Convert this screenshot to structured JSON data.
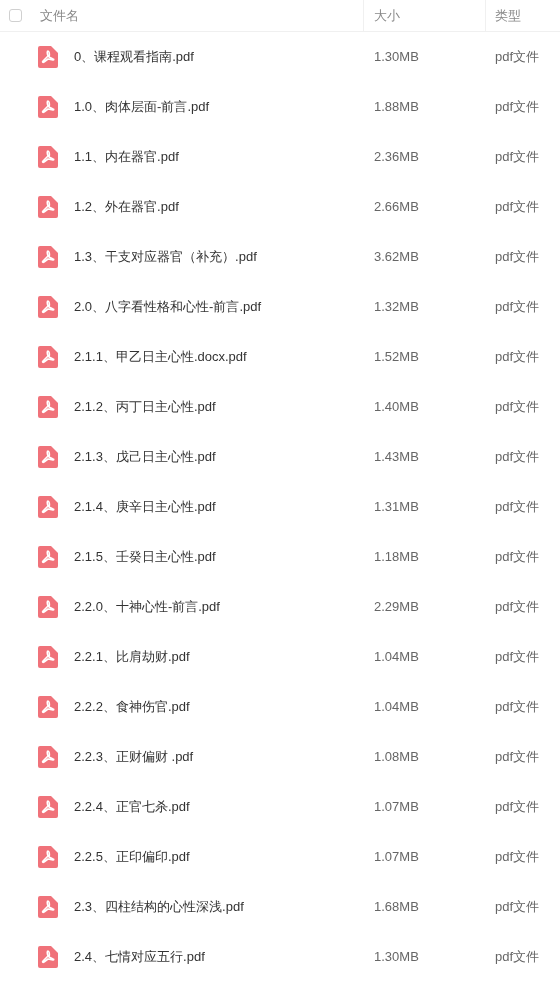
{
  "header": {
    "checked": false,
    "columns": [
      "文件名",
      "大小",
      "类型"
    ]
  },
  "files": [
    {
      "name": "0、课程观看指南.pdf",
      "size": "1.30MB",
      "type": "pdf文件"
    },
    {
      "name": "1.0、肉体层面-前言.pdf",
      "size": "1.88MB",
      "type": "pdf文件"
    },
    {
      "name": "1.1、内在器官.pdf",
      "size": "2.36MB",
      "type": "pdf文件"
    },
    {
      "name": "1.2、外在器官.pdf",
      "size": "2.66MB",
      "type": "pdf文件"
    },
    {
      "name": "1.3、干支对应器官（补充）.pdf",
      "size": "3.62MB",
      "type": "pdf文件"
    },
    {
      "name": "2.0、八字看性格和心性-前言.pdf",
      "size": "1.32MB",
      "type": "pdf文件"
    },
    {
      "name": "2.1.1、甲乙日主心性.docx.pdf",
      "size": "1.52MB",
      "type": "pdf文件"
    },
    {
      "name": "2.1.2、丙丁日主心性.pdf",
      "size": "1.40MB",
      "type": "pdf文件"
    },
    {
      "name": "2.1.3、戊己日主心性.pdf",
      "size": "1.43MB",
      "type": "pdf文件"
    },
    {
      "name": "2.1.4、庚辛日主心性.pdf",
      "size": "1.31MB",
      "type": "pdf文件"
    },
    {
      "name": "2.1.5、壬癸日主心性.pdf",
      "size": "1.18MB",
      "type": "pdf文件"
    },
    {
      "name": "2.2.0、十神心性-前言.pdf",
      "size": "2.29MB",
      "type": "pdf文件"
    },
    {
      "name": "2.2.1、比肩劫财.pdf",
      "size": "1.04MB",
      "type": "pdf文件"
    },
    {
      "name": "2.2.2、食神伤官.pdf",
      "size": "1.04MB",
      "type": "pdf文件"
    },
    {
      "name": "2.2.3、正财偏财 .pdf",
      "size": "1.08MB",
      "type": "pdf文件"
    },
    {
      "name": "2.2.4、正官七杀.pdf",
      "size": "1.07MB",
      "type": "pdf文件"
    },
    {
      "name": "2.2.5、正印偏印.pdf",
      "size": "1.07MB",
      "type": "pdf文件"
    },
    {
      "name": "2.3、四柱结构的心性深浅.pdf",
      "size": "1.68MB",
      "type": "pdf文件"
    },
    {
      "name": "2.4、七情对应五行.pdf",
      "size": "1.30MB",
      "type": "pdf文件"
    }
  ]
}
